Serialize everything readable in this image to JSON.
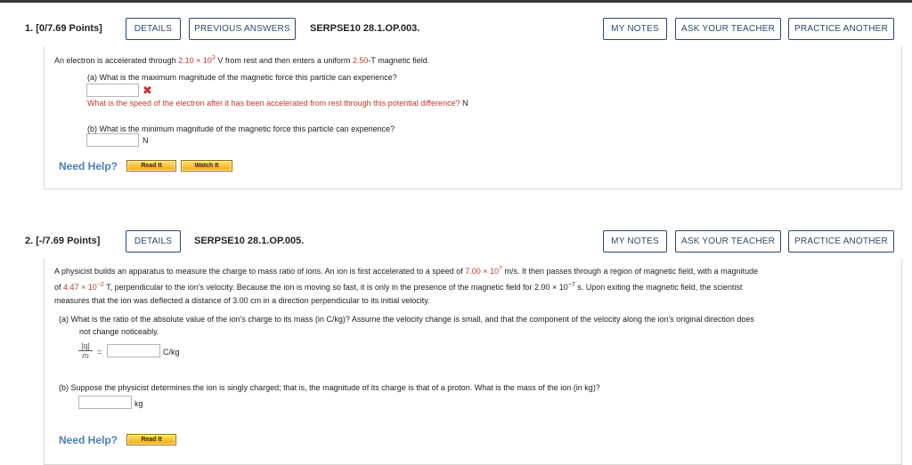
{
  "q1": {
    "number": "1. [0/7.69 Points]",
    "details": "DETAILS",
    "previous_answers": "PREVIOUS ANSWERS",
    "code": "SERPSE10 28.1.OP.003.",
    "my_notes": "MY NOTES",
    "ask_teacher": "ASK YOUR TEACHER",
    "practice": "PRACTICE ANOTHER",
    "stmt_a": "An electron is accelerated through ",
    "stmt_v_val": "2.10",
    "stmt_times": " × 10",
    "stmt_exp": "3",
    "stmt_b": " V from rest and then enters a uniform ",
    "stmt_b_val": "2.50",
    "stmt_c": "-T magnetic field.",
    "part_a": "(a) What is the maximum magnitude of the magnetic force this particle can experience?",
    "hint": "What is the speed of the electron after it has been accelerated from rest through this potential difference?",
    "hint_unit": "N",
    "part_b": "(b) What is the minimum magnitude of the magnetic force this particle can experience?",
    "part_b_unit": "N",
    "need_help": "Need Help?",
    "read_it": "Read It",
    "watch_it": "Watch It"
  },
  "q2": {
    "number": "2. [-/7.69 Points]",
    "details": "DETAILS",
    "code": "SERPSE10 28.1.OP.005.",
    "my_notes": "MY NOTES",
    "ask_teacher": "ASK YOUR TEACHER",
    "practice": "PRACTICE ANOTHER",
    "l1_a": "A physicist builds an apparatus to measure the charge to mass ratio of ions. An ion is first accelerated to a speed of ",
    "l1_val": "7.00",
    "l1_times": " × 10",
    "l1_exp": "7",
    "l1_b": " m/s. It then passes through a region of magnetic field, with a magnitude",
    "l2_a": "of ",
    "l2_val": "4.47",
    "l2_times": " × 10",
    "l2_exp": "−2",
    "l2_b": " T, perpendicular to the ion's velocity. Because the ion is moving so fast, it is only in the presence of the magnetic field for 2.00 × 10",
    "l2_exp2": "−7",
    "l2_c": " s. Upon exiting the magnetic field, the scientist",
    "l3": "measures that the ion was deflected a distance of 3.00 cm in a direction perpendicular to its initial velocity.",
    "part_a_1": "(a)   What is the ratio of the absolute value of the ion's charge to its mass (in C/kg)? Assume the velocity change is small, and that the component of the velocity along the ion's original direction does",
    "part_a_2": "not change noticeably.",
    "frac_top": "|q|",
    "frac_bot": "m",
    "equals": "=",
    "part_a_unit": "C/kg",
    "part_b": "(b)   Suppose the physicist determines the ion is singly charged; that is, the magnitude of its charge is that of a proton. What is the mass of the ion (in kg)?",
    "part_b_unit": "kg",
    "need_help": "Need Help?",
    "read_it": "Read It"
  }
}
